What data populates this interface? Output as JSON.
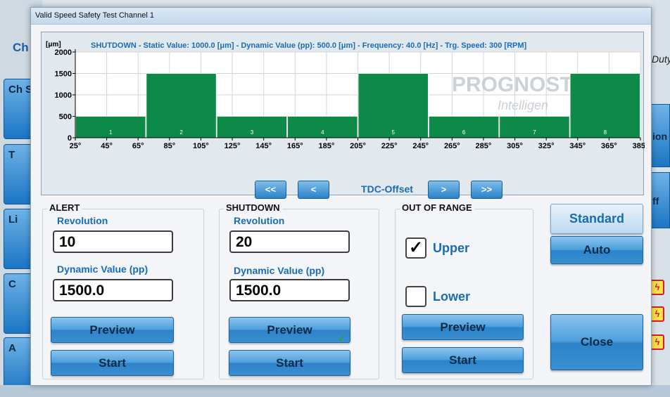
{
  "background": {
    "title_fragment": "Ch",
    "left_tabs": [
      "Ch",
      "Ch St",
      "T",
      "Li",
      "C",
      "A"
    ],
    "right_tabs": [
      "ion",
      "ff"
    ],
    "duty_fragment": "Duty",
    "bolt_glyph": "ϟ"
  },
  "dialog": {
    "title": "Valid Speed Safety Test Channel 1",
    "chart_unit": "[μm]",
    "chart_title": "SHUTDOWN - Static Value: 1000.0 [μm] - Dynamic Value (pp): 500.0 [μm] - Frequency: 40.0 [Hz] - Trg. Speed: 300 [RPM]",
    "watermark": {
      "brand": "PROGNOST",
      "sub": "Intelligen"
    },
    "nav": {
      "first": "<<",
      "prev": "<",
      "label": "TDC-Offset",
      "next": ">",
      "last": ">>"
    },
    "alert": {
      "title": "ALERT",
      "revolution_label": "Revolution",
      "revolution_value": "10",
      "dynamic_label": "Dynamic Value (pp)",
      "dynamic_value": "1500.0",
      "preview_label": "Preview",
      "start_label": "Start"
    },
    "shutdown": {
      "title": "SHUTDOWN",
      "revolution_label": "Revolution",
      "revolution_value": "20",
      "dynamic_label": "Dynamic Value (pp)",
      "dynamic_value": "1500.0",
      "preview_label": "Preview",
      "preview_check": "✓",
      "start_label": "Start"
    },
    "out_of_range": {
      "title": "OUT OF RANGE",
      "upper_label": "Upper",
      "upper_checked": true,
      "upper_mark": "✓",
      "lower_label": "Lower",
      "lower_checked": false,
      "preview_label": "Preview",
      "start_label": "Start"
    },
    "mode": {
      "standard_label": "Standard",
      "auto_label": "Auto"
    },
    "close_label": "Close",
    "colors": {
      "bar": "#0e8a48",
      "accent": "#1b6bb3",
      "button": "#3a8fd2"
    }
  },
  "chart_data": {
    "type": "bar",
    "title": "SHUTDOWN - Static Value: 1000.0 [μm] - Dynamic Value (pp): 500.0 [μm] - Frequency: 40.0 [Hz] - Trg. Speed: 300 [RPM]",
    "ylabel": "[μm]",
    "ylim": [
      0,
      2000
    ],
    "yticks": [
      0,
      500,
      1000,
      1500,
      2000
    ],
    "xlim": [
      25,
      385
    ],
    "xticks": [
      "25°",
      "45°",
      "65°",
      "85°",
      "105°",
      "125°",
      "145°",
      "165°",
      "185°",
      "205°",
      "225°",
      "245°",
      "265°",
      "285°",
      "305°",
      "325°",
      "345°",
      "365°",
      "385°"
    ],
    "xtick_values": [
      25,
      45,
      65,
      85,
      105,
      125,
      145,
      165,
      185,
      205,
      225,
      245,
      265,
      285,
      305,
      325,
      345,
      365,
      385
    ],
    "bars": [
      {
        "label": "1",
        "start": 25,
        "end": 70,
        "value": 500
      },
      {
        "label": "2",
        "start": 70,
        "end": 115,
        "value": 1500
      },
      {
        "label": "3",
        "start": 115,
        "end": 160,
        "value": 500
      },
      {
        "label": "4",
        "start": 160,
        "end": 205,
        "value": 500
      },
      {
        "label": "5",
        "start": 205,
        "end": 250,
        "value": 1500
      },
      {
        "label": "6",
        "start": 250,
        "end": 295,
        "value": 500
      },
      {
        "label": "7",
        "start": 295,
        "end": 340,
        "value": 500
      },
      {
        "label": "8",
        "start": 340,
        "end": 385,
        "value": 1500
      }
    ],
    "grid": true
  }
}
